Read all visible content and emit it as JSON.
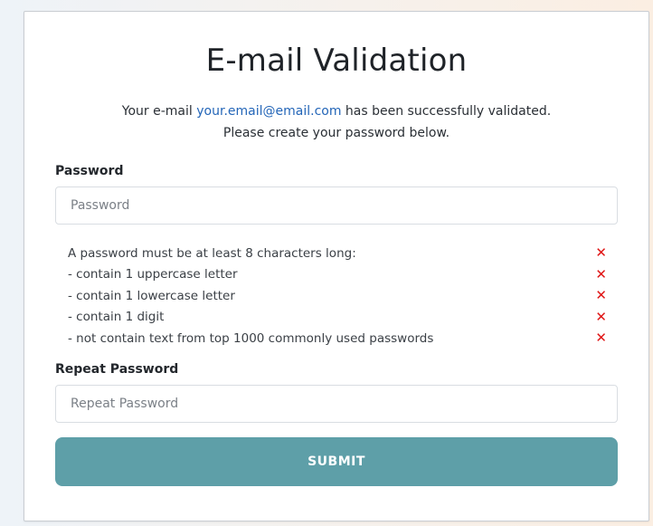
{
  "card": {
    "title": "E-mail Validation",
    "message_prefix": "Your e-mail",
    "email": "your.email@email.com",
    "message_suffix": "has been successfully validated.",
    "message_line2": "Please create your password below."
  },
  "password": {
    "label": "Password",
    "placeholder": "Password"
  },
  "rules": {
    "status_icon": "cross-icon",
    "status_color": "#e01515",
    "items": [
      {
        "text": "A password must be at least 8 characters long:",
        "status": "✕"
      },
      {
        "text": "- contain 1 uppercase letter",
        "status": "✕"
      },
      {
        "text": "- contain 1 lowercase letter",
        "status": "✕"
      },
      {
        "text": "- contain 1 digit",
        "status": "✕"
      },
      {
        "text": "- not contain text from top 1000 commonly used passwords",
        "status": "✕"
      }
    ]
  },
  "repeat_password": {
    "label": "Repeat Password",
    "placeholder": "Repeat Password"
  },
  "submit": {
    "label": "SUBMIT",
    "color": "#5e9fa8"
  }
}
